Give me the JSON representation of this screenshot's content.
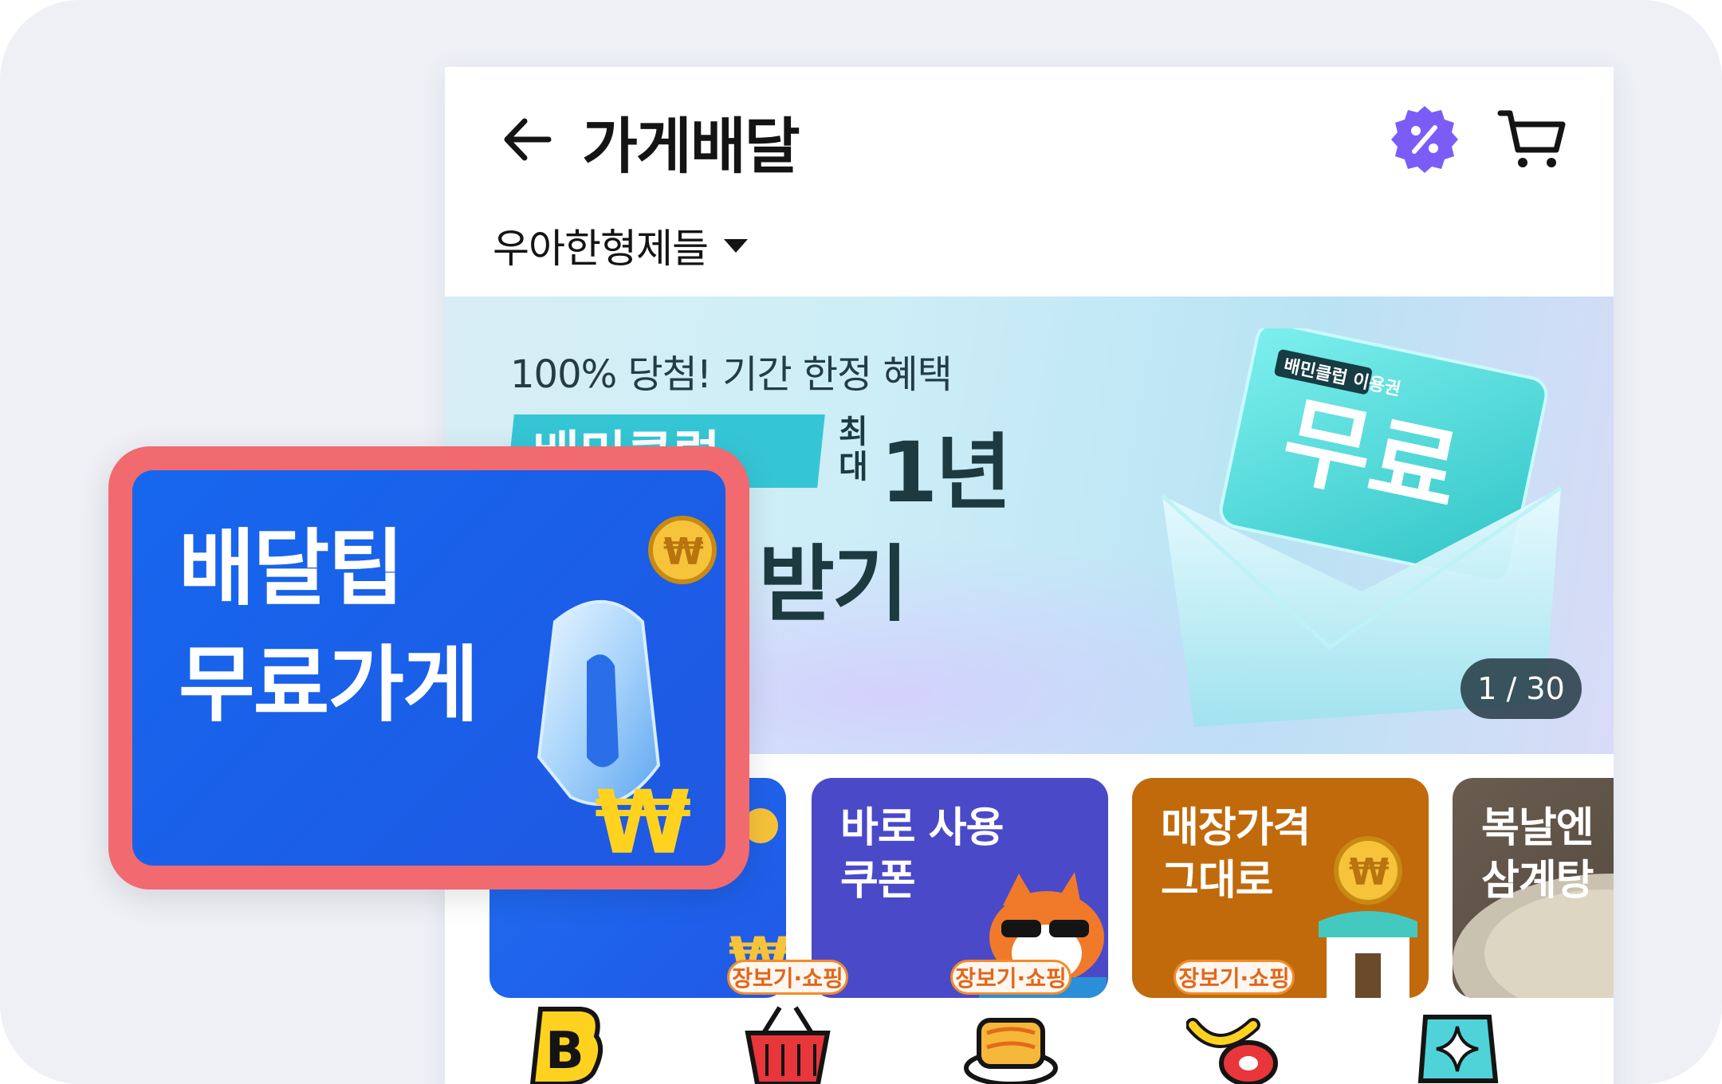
{
  "header": {
    "title": "가게배달",
    "address": "우아한형제들"
  },
  "banner": {
    "subtitle": "100% 당첨! 기간 한정 혜택",
    "pill_text": "배민클럽",
    "max_label": "최대",
    "year_text": "1년",
    "headline": "이용권 받기",
    "card_brand": "배민클럽 이용권",
    "card_text": "무료",
    "page_indicator": "1 / 30"
  },
  "tiles": [
    {
      "label": "배달팁\n무료가게"
    },
    {
      "label": "바로 사용\n쿠폰"
    },
    {
      "label": "매장가격\n그대로"
    },
    {
      "label": "복날엔\n삼계탕"
    }
  ],
  "icon_row": {
    "badge": "장보기·쇼핑"
  },
  "callout": {
    "label": "배달팁\n무료가게"
  },
  "colors": {
    "accent_purple": "#7c5cf6",
    "callout_border": "#f06a6f",
    "tile_blue": "#1e6cf0",
    "tile_indigo": "#4a49c8",
    "tile_orange": "#c06a0c",
    "badge_orange": "#f48a2a"
  },
  "icons": [
    "back-arrow-icon",
    "discount-badge-icon",
    "cart-icon",
    "caret-down-icon"
  ]
}
